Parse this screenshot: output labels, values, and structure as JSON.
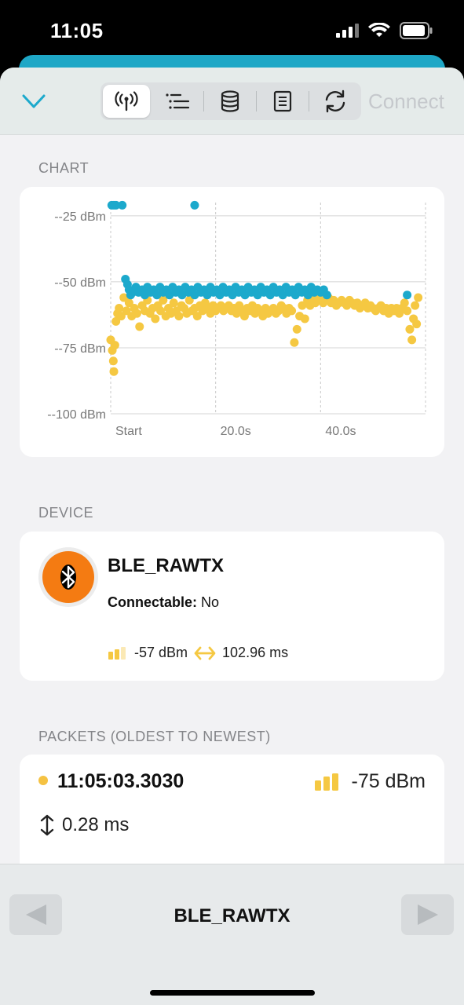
{
  "status_bar": {
    "time": "11:05"
  },
  "toolbar": {
    "tabs": [
      {
        "icon": "antenna-icon",
        "active": true
      },
      {
        "icon": "list-icon",
        "active": false
      },
      {
        "icon": "database-icon",
        "active": false
      },
      {
        "icon": "document-icon",
        "active": false
      },
      {
        "icon": "refresh-icon",
        "active": false
      }
    ],
    "connect_label": "Connect"
  },
  "sections": {
    "chart_label": "CHART",
    "device_label": "DEVICE",
    "packets_label": "PACKETS (OLDEST TO NEWEST)"
  },
  "chart_data": {
    "type": "scatter",
    "x_ticks": [
      "Start",
      "20.0s",
      "40.0s"
    ],
    "x_tick_values": [
      0,
      20,
      40
    ],
    "xlim": [
      0,
      60
    ],
    "y_ticks": [
      "--25 dBm",
      "--50 dBm",
      "--75 dBm",
      "--100 dBm"
    ],
    "y_tick_values": [
      -25,
      -50,
      -75,
      -100
    ],
    "ylim": [
      -100,
      -20
    ],
    "grid": true,
    "series": [
      {
        "color": "#1ca9cc",
        "points": [
          [
            0.2,
            -21
          ],
          [
            0.6,
            -21
          ],
          [
            1,
            -21
          ],
          [
            2.2,
            -21
          ],
          [
            16,
            -21
          ],
          [
            2.8,
            -49
          ],
          [
            3.2,
            -51
          ],
          [
            3.5,
            -53
          ],
          [
            3.8,
            -55
          ],
          [
            4.2,
            -54
          ],
          [
            4.8,
            -52
          ],
          [
            5.3,
            -54
          ],
          [
            6,
            -53
          ],
          [
            6.5,
            -55
          ],
          [
            7,
            -52
          ],
          [
            7.6,
            -54
          ],
          [
            8.2,
            -53
          ],
          [
            8.8,
            -55
          ],
          [
            9.4,
            -52
          ],
          [
            10,
            -54
          ],
          [
            10.6,
            -53
          ],
          [
            11.2,
            -55
          ],
          [
            11.8,
            -52
          ],
          [
            12.4,
            -54
          ],
          [
            13,
            -53
          ],
          [
            13.6,
            -55
          ],
          [
            14.2,
            -52
          ],
          [
            14.8,
            -54
          ],
          [
            15.4,
            -53
          ],
          [
            16,
            -55
          ],
          [
            16.6,
            -52
          ],
          [
            17.2,
            -54
          ],
          [
            17.8,
            -53
          ],
          [
            18.4,
            -55
          ],
          [
            19,
            -52
          ],
          [
            19.6,
            -54
          ],
          [
            20.2,
            -53
          ],
          [
            20.8,
            -55
          ],
          [
            21.4,
            -52
          ],
          [
            22,
            -54
          ],
          [
            22.6,
            -53
          ],
          [
            23.2,
            -55
          ],
          [
            23.8,
            -52
          ],
          [
            24.4,
            -54
          ],
          [
            25,
            -53
          ],
          [
            25.6,
            -55
          ],
          [
            26.2,
            -52
          ],
          [
            26.8,
            -54
          ],
          [
            27.4,
            -53
          ],
          [
            28,
            -55
          ],
          [
            28.6,
            -52
          ],
          [
            29.2,
            -54
          ],
          [
            29.8,
            -53
          ],
          [
            30.4,
            -55
          ],
          [
            31,
            -52
          ],
          [
            31.6,
            -54
          ],
          [
            32.2,
            -53
          ],
          [
            32.8,
            -55
          ],
          [
            33.4,
            -52
          ],
          [
            34,
            -54
          ],
          [
            34.6,
            -53
          ],
          [
            35.2,
            -55
          ],
          [
            35.8,
            -52
          ],
          [
            36.4,
            -54
          ],
          [
            37,
            -53
          ],
          [
            37.6,
            -55
          ],
          [
            38.2,
            -52
          ],
          [
            38.8,
            -54
          ],
          [
            39.4,
            -53
          ],
          [
            40,
            -54
          ],
          [
            40.6,
            -53
          ],
          [
            41.2,
            -55
          ],
          [
            56.5,
            -55
          ]
        ]
      },
      {
        "color": "#f5c842",
        "points": [
          [
            0,
            -72
          ],
          [
            0.3,
            -76
          ],
          [
            0.5,
            -80
          ],
          [
            0.6,
            -84
          ],
          [
            0.8,
            -74
          ],
          [
            1,
            -65
          ],
          [
            1.3,
            -62
          ],
          [
            1.6,
            -60
          ],
          [
            2,
            -63
          ],
          [
            2.5,
            -56
          ],
          [
            3,
            -61
          ],
          [
            3.5,
            -58
          ],
          [
            4,
            -63
          ],
          [
            4.5,
            -60
          ],
          [
            5,
            -62
          ],
          [
            5.5,
            -67
          ],
          [
            6,
            -59
          ],
          [
            6.5,
            -61
          ],
          [
            7,
            -57
          ],
          [
            7.5,
            -62
          ],
          [
            8,
            -60
          ],
          [
            8.5,
            -64
          ],
          [
            9,
            -59
          ],
          [
            9.5,
            -61
          ],
          [
            10,
            -57
          ],
          [
            10.5,
            -63
          ],
          [
            11,
            -60
          ],
          [
            11.5,
            -62
          ],
          [
            12,
            -58
          ],
          [
            12.5,
            -61
          ],
          [
            13,
            -63
          ],
          [
            13.5,
            -59
          ],
          [
            14,
            -60
          ],
          [
            14.5,
            -62
          ],
          [
            15,
            -57
          ],
          [
            15.5,
            -61
          ],
          [
            16,
            -60
          ],
          [
            16.5,
            -63
          ],
          [
            17,
            -59
          ],
          [
            17.5,
            -61
          ],
          [
            18,
            -58
          ],
          [
            18.5,
            -60
          ],
          [
            19,
            -62
          ],
          [
            19.5,
            -59
          ],
          [
            20,
            -61
          ],
          [
            20.5,
            -60
          ],
          [
            21,
            -59
          ],
          [
            21.5,
            -61
          ],
          [
            22,
            -60
          ],
          [
            22.5,
            -59
          ],
          [
            23,
            -61
          ],
          [
            23.5,
            -60
          ],
          [
            24,
            -62
          ],
          [
            24.5,
            -59
          ],
          [
            25,
            -61
          ],
          [
            25.5,
            -63
          ],
          [
            26,
            -60
          ],
          [
            26.5,
            -61
          ],
          [
            27,
            -59
          ],
          [
            27.5,
            -62
          ],
          [
            28,
            -60
          ],
          [
            28.5,
            -61
          ],
          [
            29,
            -63
          ],
          [
            29.5,
            -60
          ],
          [
            30,
            -62
          ],
          [
            30.5,
            -61
          ],
          [
            31,
            -60
          ],
          [
            31.5,
            -62
          ],
          [
            32,
            -61
          ],
          [
            32.5,
            -59
          ],
          [
            33,
            -60
          ],
          [
            33.5,
            -62
          ],
          [
            34,
            -60
          ],
          [
            34.5,
            -61
          ],
          [
            35,
            -73
          ],
          [
            35.5,
            -68
          ],
          [
            36,
            -63
          ],
          [
            36.5,
            -59
          ],
          [
            37,
            -64
          ],
          [
            37.5,
            -57
          ],
          [
            38,
            -59
          ],
          [
            38.5,
            -57
          ],
          [
            39,
            -58
          ],
          [
            39.5,
            -56
          ],
          [
            40,
            -57
          ],
          [
            40.5,
            -58
          ],
          [
            41,
            -57
          ],
          [
            41.5,
            -56
          ],
          [
            42,
            -58
          ],
          [
            42.5,
            -57
          ],
          [
            43,
            -59
          ],
          [
            43.5,
            -58
          ],
          [
            44,
            -57
          ],
          [
            44.5,
            -58
          ],
          [
            45,
            -59
          ],
          [
            45.5,
            -57
          ],
          [
            46,
            -58
          ],
          [
            46.5,
            -59
          ],
          [
            47,
            -58
          ],
          [
            47.5,
            -60
          ],
          [
            48,
            -59
          ],
          [
            48.5,
            -58
          ],
          [
            49,
            -60
          ],
          [
            49.5,
            -59
          ],
          [
            50,
            -60
          ],
          [
            50.5,
            -61
          ],
          [
            51,
            -60
          ],
          [
            51.5,
            -59
          ],
          [
            52,
            -61
          ],
          [
            52.5,
            -60
          ],
          [
            53,
            -62
          ],
          [
            53.5,
            -60
          ],
          [
            54,
            -61
          ],
          [
            54.5,
            -60
          ],
          [
            55,
            -62
          ],
          [
            55.5,
            -60
          ],
          [
            56,
            -58
          ],
          [
            56.5,
            -61
          ],
          [
            57,
            -68
          ],
          [
            57.4,
            -72
          ],
          [
            57.7,
            -64
          ],
          [
            58,
            -59
          ],
          [
            58.3,
            -66
          ],
          [
            58.6,
            -56
          ]
        ]
      }
    ]
  },
  "device": {
    "name": "BLE_RAWTX",
    "connectable_label": "Connectable:",
    "connectable_value": "No",
    "rssi": "-57 dBm",
    "interval": "102.96 ms"
  },
  "packets": [
    {
      "time": "11:05:03.3030",
      "rssi": "-75 dBm",
      "delta": "0.28 ms"
    }
  ],
  "bottom": {
    "title": "BLE_RAWTX"
  }
}
